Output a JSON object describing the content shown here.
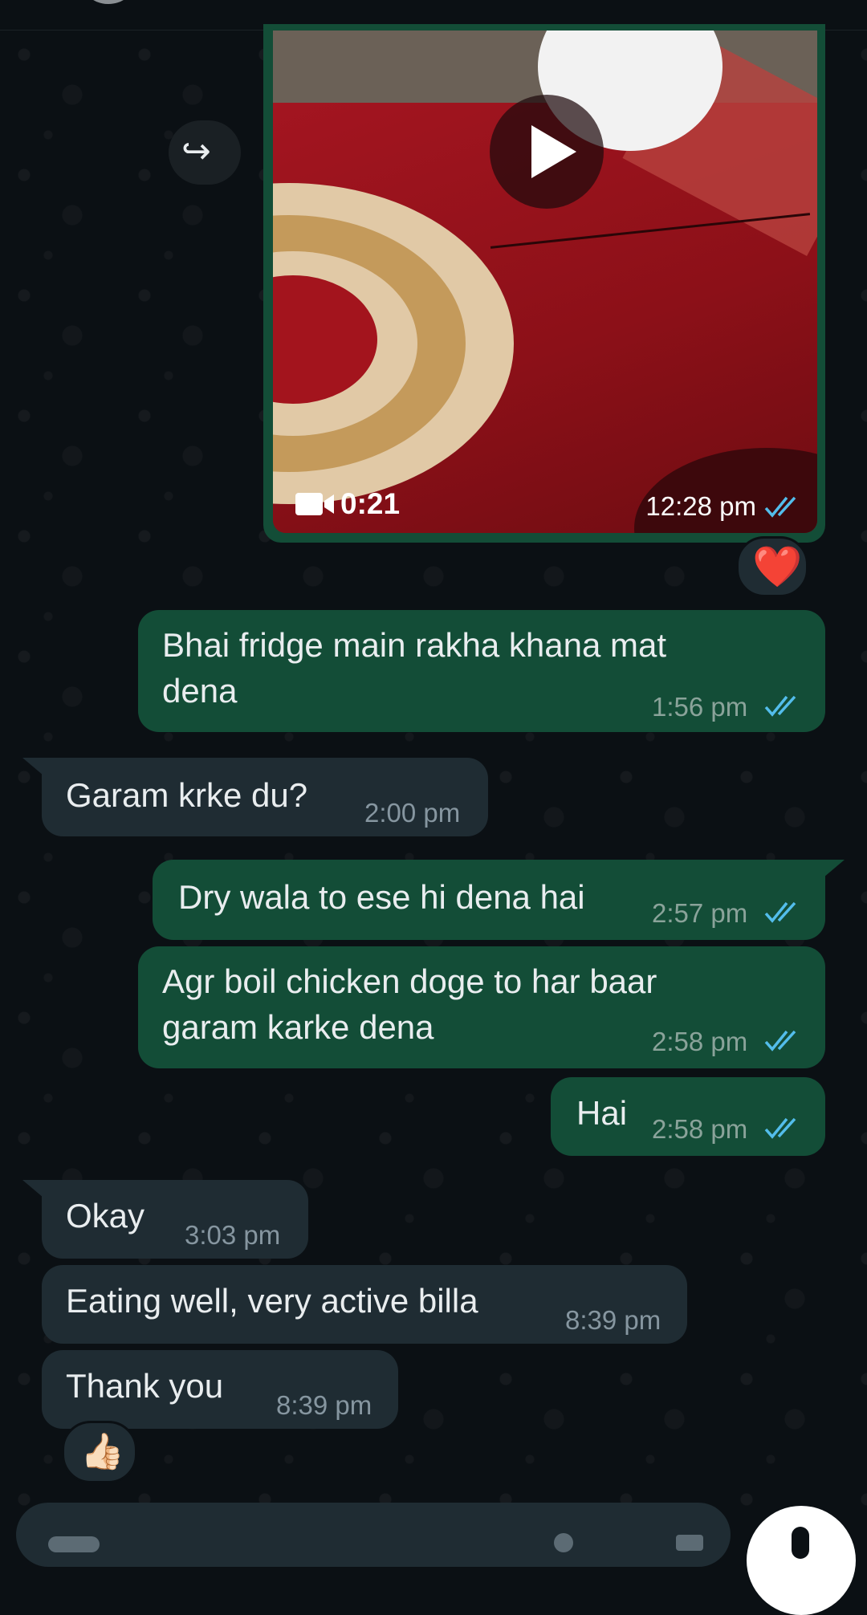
{
  "video_message": {
    "duration": "0:21",
    "time": "12:28 pm",
    "reaction": "❤️",
    "forward_icon": "forward-icon",
    "play_icon": "play-icon"
  },
  "messages": [
    {
      "dir": "out",
      "text": "Bhai fridge main rakha khana mat dena",
      "time": "1:56 pm"
    },
    {
      "dir": "in",
      "text": "Garam krke du?",
      "time": "2:00 pm"
    },
    {
      "dir": "out",
      "text": "Dry wala to ese hi dena hai",
      "time": "2:57 pm"
    },
    {
      "dir": "out",
      "text": "Agr boil chicken doge to har baar garam karke dena",
      "time": "2:58 pm"
    },
    {
      "dir": "out",
      "text": "Hai",
      "time": "2:58 pm"
    },
    {
      "dir": "in",
      "text": "Okay",
      "time": "3:03 pm"
    },
    {
      "dir": "in",
      "text": "Eating well, very active billa",
      "time": "8:39 pm"
    },
    {
      "dir": "in",
      "text": "Thank you",
      "time": "8:39 pm",
      "reaction": "👍🏻"
    }
  ],
  "colors": {
    "background": "#0b1014",
    "outgoing_bubble": "#134d37",
    "incoming_bubble": "#1f2c33",
    "read_ticks": "#53bdeb",
    "text": "#e9edef"
  }
}
